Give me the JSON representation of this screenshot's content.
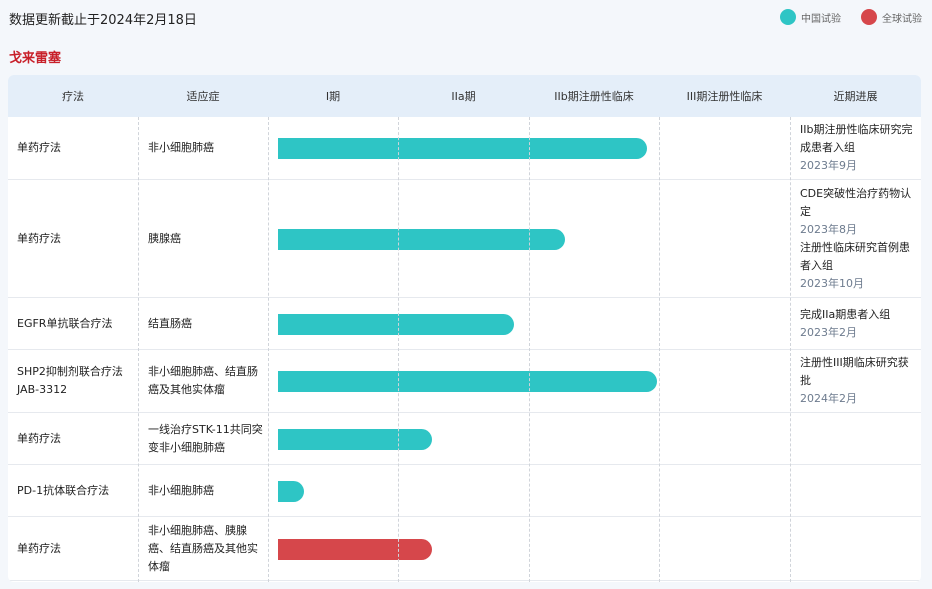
{
  "header": {
    "update_text": "数据更新截止于2024年2月18日",
    "legend": [
      {
        "label": "中国试验",
        "color": "#2ec5c5"
      },
      {
        "label": "全球试验",
        "color": "#d6474b"
      }
    ]
  },
  "drug_name": "戈来雷塞",
  "table": {
    "columns": [
      "疗法",
      "适应症",
      "I期",
      "IIa期",
      "IIb期注册性临床",
      "III期注册性临床",
      "近期进展"
    ],
    "rows": [
      {
        "therapy": "单药疗法",
        "indication": "非小细胞肺癌",
        "trial_type": "china",
        "progress_pct": 0.72,
        "updates": [
          {
            "text": "IIb期注册性临床研究完成患者入组",
            "date": "2023年9月"
          }
        ]
      },
      {
        "therapy": "单药疗法",
        "indication": "胰腺癌",
        "trial_type": "china",
        "progress_pct": 0.56,
        "updates": [
          {
            "text": "CDE突破性治疗药物认定",
            "date": "2023年8月"
          },
          {
            "text": "注册性临床研究首例患者入组",
            "date": "2023年10月"
          }
        ]
      },
      {
        "therapy": "EGFR单抗联合疗法",
        "indication": "结直肠癌",
        "trial_type": "china",
        "progress_pct": 0.46,
        "updates": [
          {
            "text": "完成IIa期患者入组",
            "date": "2023年2月"
          }
        ]
      },
      {
        "therapy": "SHP2抑制剂联合疗法JAB-3312",
        "indication": "非小细胞肺癌、结直肠癌及其他实体瘤",
        "trial_type": "china",
        "progress_pct": 0.74,
        "updates": [
          {
            "text": "注册性III期临床研究获批",
            "date": "2024年2月"
          }
        ]
      },
      {
        "therapy": "单药疗法",
        "indication": "一线治疗STK-11共同突变非小细胞肺癌",
        "trial_type": "china",
        "progress_pct": 0.3,
        "updates": []
      },
      {
        "therapy": "PD-1抗体联合疗法",
        "indication": "非小细胞肺癌",
        "trial_type": "china",
        "progress_pct": 0.05,
        "updates": []
      },
      {
        "therapy": "单药疗法",
        "indication": "非小细胞肺癌、胰腺癌、结直肠癌及其他实体瘤",
        "trial_type": "global",
        "progress_pct": 0.3,
        "updates": []
      }
    ]
  }
}
